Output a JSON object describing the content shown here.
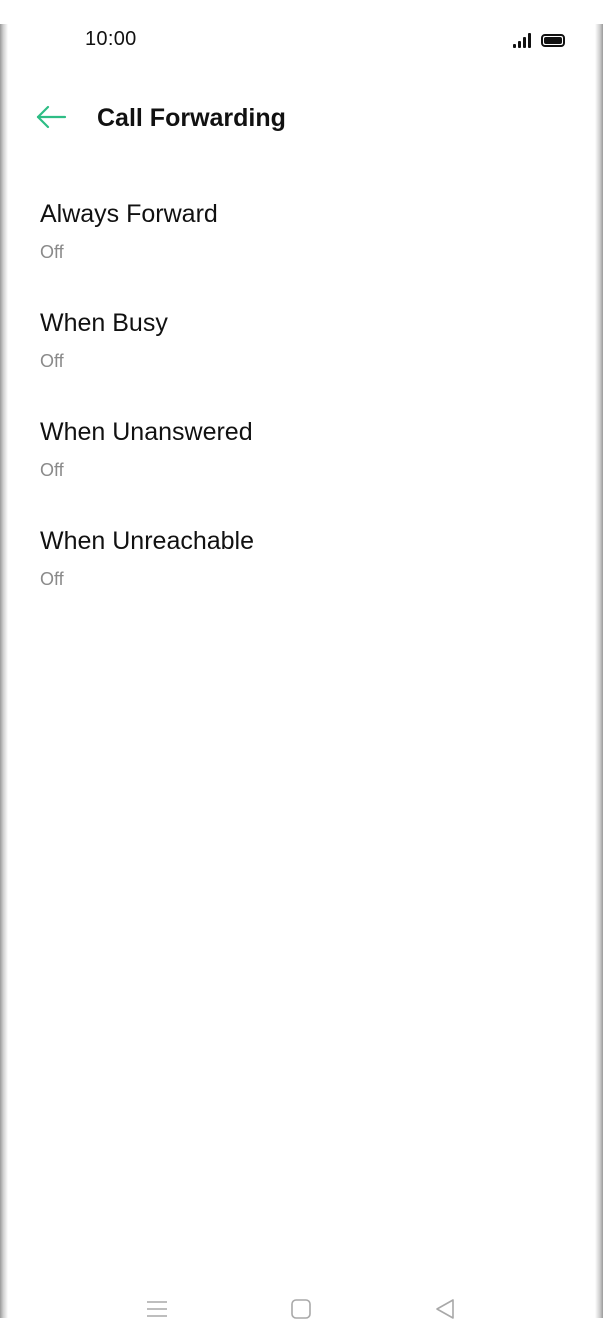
{
  "status_bar": {
    "time": "10:00"
  },
  "header": {
    "title": "Call Forwarding"
  },
  "settings": {
    "items": [
      {
        "title": "Always Forward",
        "status": "Off"
      },
      {
        "title": "When Busy",
        "status": "Off"
      },
      {
        "title": "When Unanswered",
        "status": "Off"
      },
      {
        "title": "When Unreachable",
        "status": "Off"
      }
    ]
  },
  "icons": {
    "back": "arrow-left-icon",
    "signal": "signal-icon",
    "battery": "battery-icon",
    "nav_menu": "menu-icon",
    "nav_home": "home-icon",
    "nav_back": "back-triangle-icon"
  },
  "colors": {
    "accent": "#2ebd85",
    "title_text": "#111111",
    "secondary_text": "#8a8a8a",
    "nav_icons": "#a8a8a8"
  }
}
